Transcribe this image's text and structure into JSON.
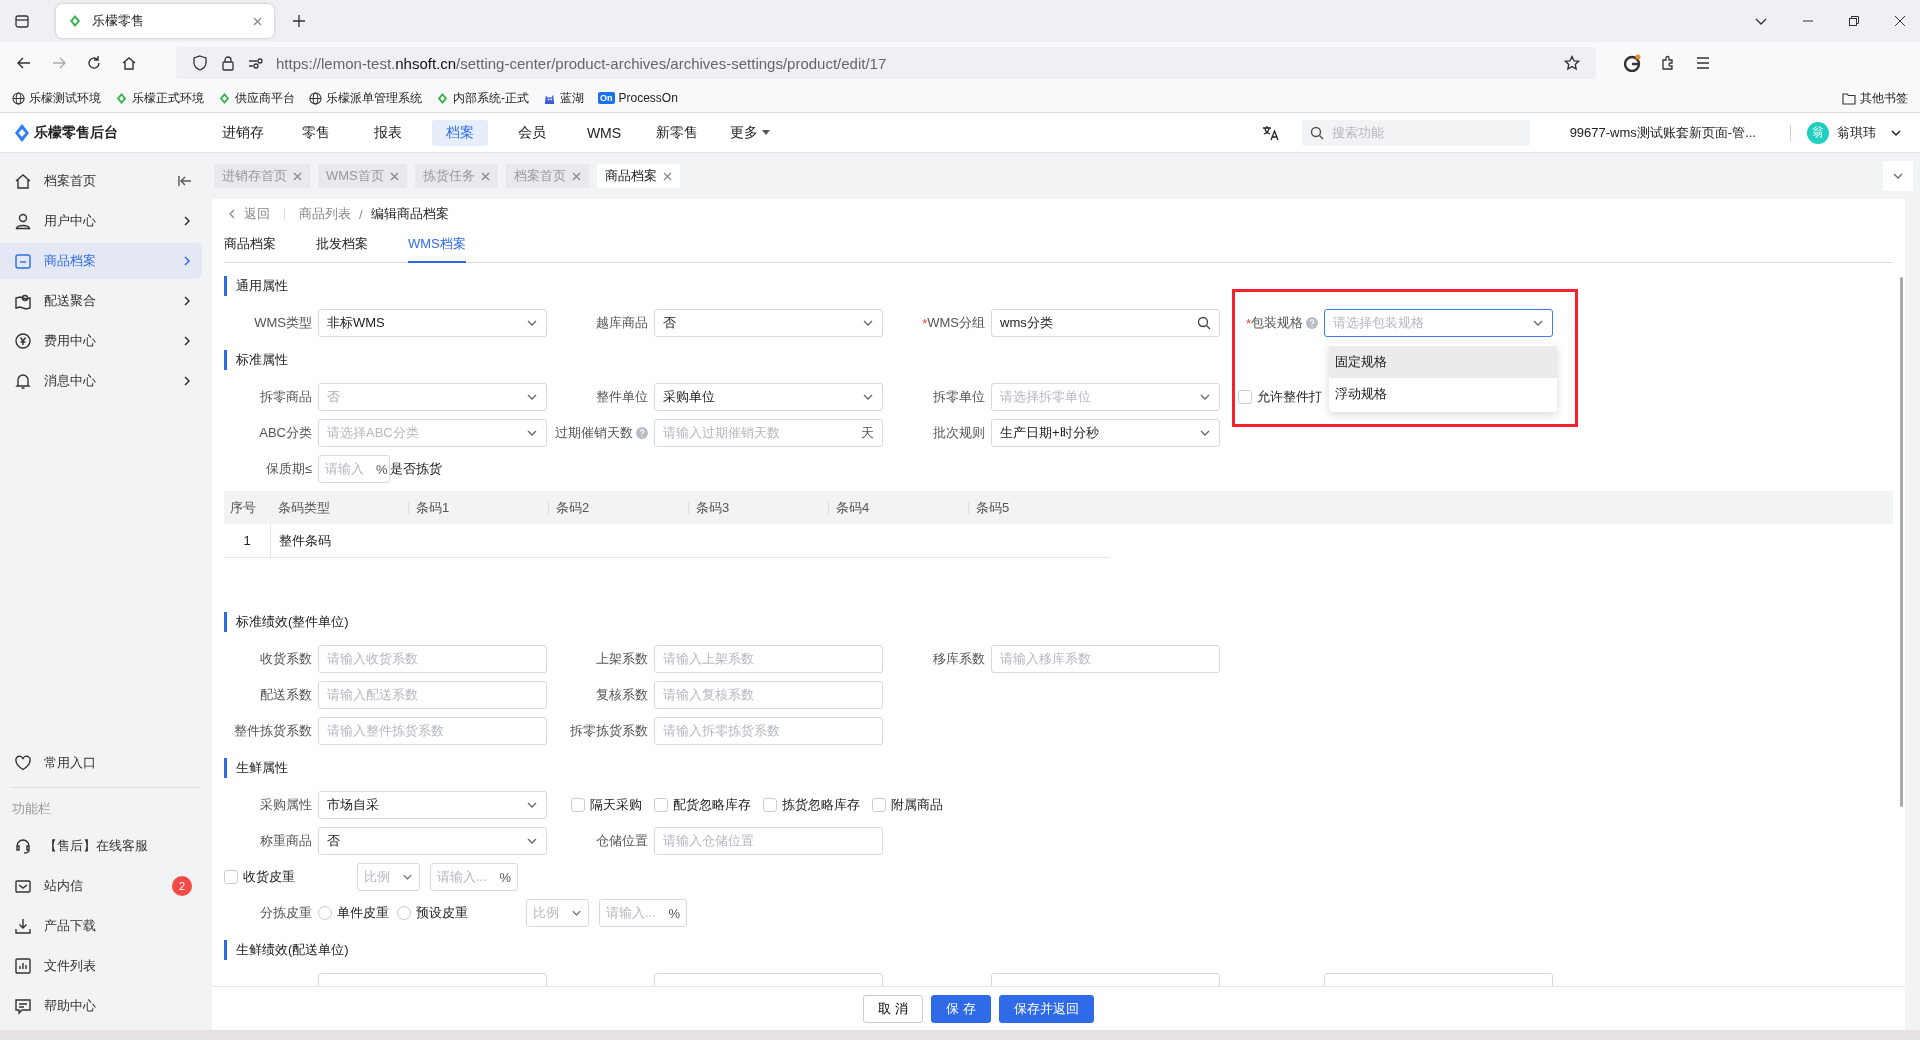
{
  "browser": {
    "tabs": [
      {
        "title": "乐檬零售",
        "selected": true
      }
    ],
    "url": {
      "prefix": "https://lemon-test.",
      "domain": "nhsoft.cn",
      "path": "/setting-center/product-archives/archives-settings/product/edit/17"
    },
    "bookmarks": [
      {
        "label": "乐檬测试环境",
        "kind": "globe"
      },
      {
        "label": "乐檬正式环境",
        "kind": "leaf"
      },
      {
        "label": "供应商平台",
        "kind": "leaf"
      },
      {
        "label": "乐檬派单管理系统",
        "kind": "globe"
      },
      {
        "label": "内部系统-正式",
        "kind": "leaf"
      },
      {
        "label": "蓝湖",
        "kind": "mascot"
      },
      {
        "label": "ProcessOn",
        "kind": "badge",
        "badge": "On"
      }
    ],
    "other_bookmarks": "其他书签"
  },
  "header": {
    "logo": "乐檬零售后台",
    "nav": [
      {
        "label": "进销存",
        "selected": false
      },
      {
        "label": "零售",
        "selected": false
      },
      {
        "label": "报表",
        "selected": false
      },
      {
        "label": "档案",
        "selected": true
      },
      {
        "label": "会员",
        "selected": false
      },
      {
        "label": "WMS",
        "selected": false
      },
      {
        "label": "新零售",
        "selected": false
      },
      {
        "label": "更多",
        "selected": false,
        "has_menu": true
      }
    ],
    "search": {
      "placeholder": "搜索功能"
    },
    "account": "99677-wms测试账套新页面-管...",
    "avatar": "翁",
    "user": "翁琪玮"
  },
  "sidebar": {
    "items": [
      {
        "label": "档案首页",
        "selected": false,
        "collapse_toggle": true
      },
      {
        "label": "用户中心",
        "selected": false
      },
      {
        "label": "商品档案",
        "selected": true
      },
      {
        "label": "配送聚合",
        "selected": false
      },
      {
        "label": "费用中心",
        "selected": false
      },
      {
        "label": "消息中心",
        "selected": false
      }
    ],
    "favorites": "常用入口",
    "tools_title": "功能栏",
    "tools": [
      {
        "label": "【售后】在线客服"
      },
      {
        "label": "站内信",
        "badge": "2"
      },
      {
        "label": "产品下载"
      },
      {
        "label": "文件列表"
      },
      {
        "label": "帮助中心"
      }
    ]
  },
  "page_tabs": [
    {
      "label": "进销存首页",
      "selected": false
    },
    {
      "label": "WMS首页",
      "selected": false
    },
    {
      "label": "拣货任务",
      "selected": false
    },
    {
      "label": "档案首页",
      "selected": false
    },
    {
      "label": "商品档案",
      "selected": true
    }
  ],
  "breadcrumb": {
    "back": "返回",
    "items": [
      "商品列表",
      "编辑商品档案"
    ],
    "separator": "/"
  },
  "sub_tabs": [
    {
      "label": "商品档案",
      "selected": false
    },
    {
      "label": "批发档案",
      "selected": false
    },
    {
      "label": "WMS档案",
      "selected": true
    }
  ],
  "required_mark": "*",
  "sections": [
    {
      "title": "通用属性",
      "rows": [
        [
          {
            "kind": "select",
            "label": "WMS类型",
            "value": "非标WMS"
          },
          {
            "kind": "select",
            "label": "越库商品",
            "value": "否"
          },
          {
            "kind": "search",
            "label": "WMS分组",
            "required": true,
            "value": "wms分类"
          },
          {
            "kind": "select",
            "label": "包装规格",
            "required": true,
            "help": true,
            "placeholder": "请选择包装规格",
            "focused": true,
            "highlighted": true,
            "menu": [
              {
                "label": "固定规格",
                "hovered": true
              },
              {
                "label": "浮动规格",
                "hovered": false
              }
            ]
          }
        ]
      ]
    },
    {
      "title": "标准属性",
      "rows": [
        [
          {
            "kind": "select",
            "label": "拆零商品",
            "value": "否",
            "disabled": true
          },
          {
            "kind": "select",
            "label": "整件单位",
            "value": "采购单位"
          },
          {
            "kind": "select",
            "label": "拆零单位",
            "placeholder": "请选择拆零单位"
          },
          {
            "kind": "checkbox",
            "label": "允许整件打",
            "checked": false
          }
        ],
        [
          {
            "kind": "select",
            "label": "ABC分类",
            "placeholder": "请选择ABC分类"
          },
          {
            "kind": "input",
            "label": "过期催销天数",
            "help": true,
            "placeholder": "请输入过期催销天数",
            "suffix": "天"
          },
          {
            "kind": "select",
            "label": "批次规则",
            "value": "生产日期+时分秒"
          }
        ],
        [
          {
            "kind": "short_input",
            "label": "保质期≤",
            "placeholder": "请输入",
            "suffix": "%",
            "after": "是否拣货"
          }
        ]
      ],
      "table": {
        "columns": [
          "序号",
          "条码类型",
          "条码1",
          "条码2",
          "条码3",
          "条码4",
          "条码5"
        ],
        "rows": [
          [
            "1",
            "整件条码"
          ]
        ]
      }
    },
    {
      "title": "标准绩效(整件单位)",
      "rows": [
        [
          {
            "kind": "input",
            "label": "收货系数",
            "placeholder": "请输入收货系数"
          },
          {
            "kind": "input",
            "label": "上架系数",
            "placeholder": "请输入上架系数"
          },
          {
            "kind": "input",
            "label": "移库系数",
            "placeholder": "请输入移库系数"
          }
        ],
        [
          {
            "kind": "input",
            "label": "配送系数",
            "placeholder": "请输入配送系数"
          },
          {
            "kind": "input",
            "label": "复核系数",
            "placeholder": "请输入复核系数"
          }
        ],
        [
          {
            "kind": "input",
            "label": "整件拣货系数",
            "placeholder": "请输入整件拣货系数"
          },
          {
            "kind": "input",
            "label": "拆零拣货系数",
            "placeholder": "请输入拆零拣货系数"
          }
        ]
      ]
    },
    {
      "title": "生鲜属性",
      "rows": [
        [
          {
            "kind": "select",
            "label": "采购属性",
            "value": "市场自采"
          },
          {
            "kind": "checkgroup",
            "items": [
              {
                "label": "隔天采购",
                "checked": false
              },
              {
                "label": "配货忽略库存",
                "checked": false
              },
              {
                "label": "拣货忽略库存",
                "checked": false
              },
              {
                "label": "附属商品",
                "checked": false
              }
            ]
          }
        ],
        [
          {
            "kind": "select",
            "label": "称重商品",
            "value": "否"
          },
          {
            "kind": "input",
            "label": "仓储位置",
            "placeholder": "请输入仓储位置"
          }
        ],
        [
          {
            "kind": "tare_check",
            "label": "收货皮重",
            "checked": false,
            "mode": "比例",
            "placeholder": "请输入...",
            "suffix": "%"
          }
        ],
        [
          {
            "kind": "tare_radio",
            "label": "分拣皮重",
            "options": [
              {
                "label": "单件皮重",
                "selected": false
              },
              {
                "label": "预设皮重",
                "selected": false
              }
            ],
            "mode": "比例",
            "placeholder": "请输入...",
            "suffix": "%"
          }
        ]
      ]
    },
    {
      "title": "生鲜绩效(配送单位)",
      "rows": [
        [
          {
            "kind": "input"
          },
          {
            "kind": "input"
          },
          {
            "kind": "input"
          },
          {
            "kind": "input"
          }
        ]
      ]
    }
  ],
  "footer": {
    "buttons": [
      {
        "label": "取 消",
        "kind": "default"
      },
      {
        "label": "保 存",
        "kind": "primary"
      },
      {
        "label": "保存并返回",
        "kind": "primary"
      }
    ]
  }
}
